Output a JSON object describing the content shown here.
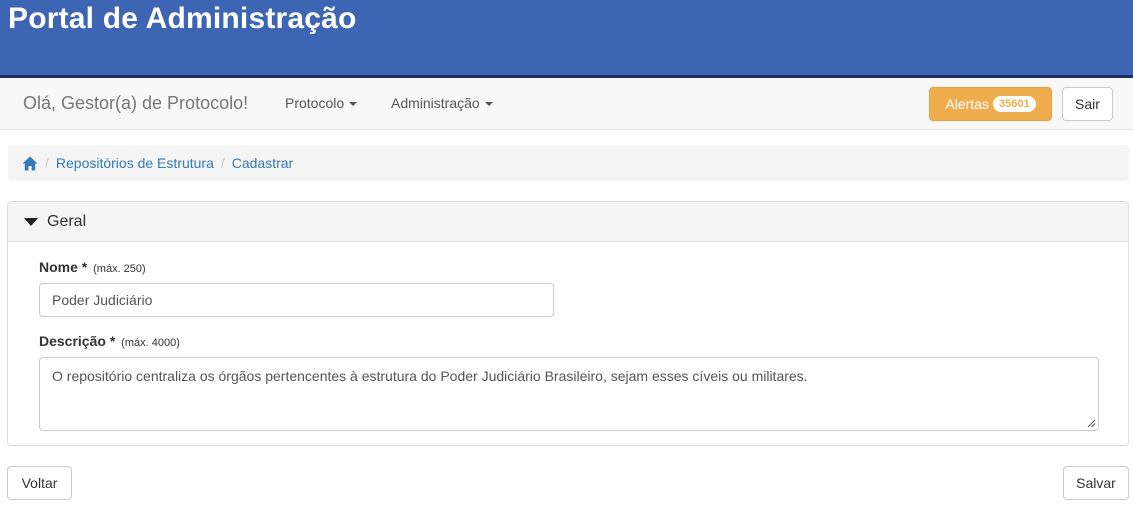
{
  "header": {
    "title": "Portal de Administração"
  },
  "navbar": {
    "greeting": "Olá, Gestor(a) de Protocolo!",
    "menus": [
      {
        "label": "Protocolo"
      },
      {
        "label": "Administração"
      }
    ],
    "alerts": {
      "label": "Alertas",
      "count": "35601"
    },
    "logout_label": "Sair"
  },
  "breadcrumb": {
    "home_icon": "home-icon",
    "items": [
      {
        "label": "Repositórios de Estrutura"
      },
      {
        "label": "Cadastrar"
      }
    ]
  },
  "panel": {
    "title": "Geral",
    "nome": {
      "label": "Nome *",
      "hint": "(máx. 250)",
      "value": "Poder Judiciário"
    },
    "descricao": {
      "label": "Descrição *",
      "hint": "(máx. 4000)",
      "value": "O repositório centraliza os órgãos pertencentes à estrutura do Poder Judiciário Brasileiro, sejam esses cíveis ou militares."
    }
  },
  "footer": {
    "back_label": "Voltar",
    "save_label": "Salvar"
  },
  "colors": {
    "header_bg": "#3d65b3",
    "link": "#337ab7",
    "warning": "#f0ad4e"
  }
}
